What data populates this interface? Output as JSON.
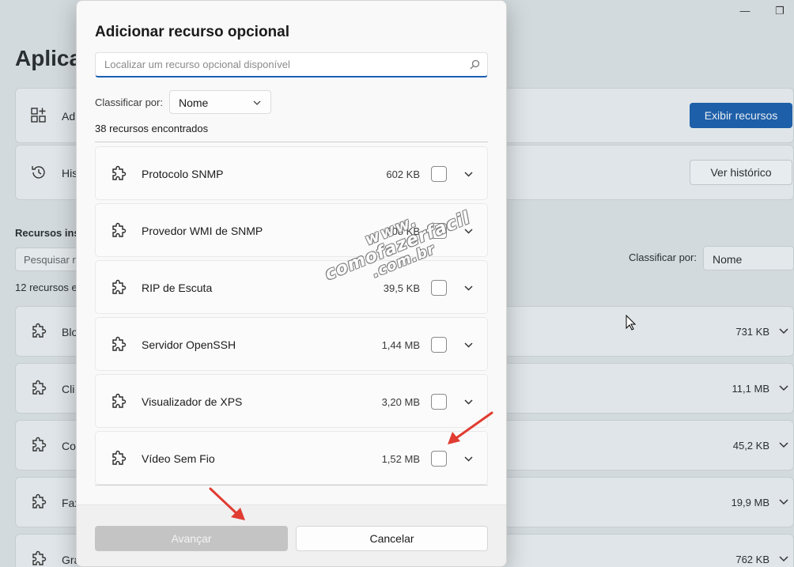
{
  "background": {
    "title": "Aplica",
    "cards": [
      {
        "label": "Ad",
        "icon": "add-grid-icon"
      },
      {
        "label": "His",
        "icon": "history-icon"
      }
    ],
    "view_features_button": "Exibir recursos",
    "view_history_button": "Ver histórico",
    "installed_section": "Recursos ins",
    "search_placeholder": "Pesquisar r",
    "sort_label": "Classificar por:",
    "sort_value": "Nome",
    "count": "12 recursos e",
    "rows": [
      {
        "label": "Blo",
        "size": "731 KB"
      },
      {
        "label": "Cli",
        "size": "11,1 MB"
      },
      {
        "label": "Co",
        "size": "45,2 KB"
      },
      {
        "label": "Fax",
        "size": "19,9 MB"
      },
      {
        "label": "Gra",
        "size": "762 KB"
      }
    ]
  },
  "dialog": {
    "title": "Adicionar recurso opcional",
    "search_placeholder": "Localizar um recurso opcional disponível",
    "sort_label": "Classificar por:",
    "sort_value": "Nome",
    "count": "38 recursos encontrados",
    "features": [
      {
        "name": "Protocolo SNMP",
        "size": "602 KB"
      },
      {
        "name": "Provedor WMI de SNMP",
        "size": "808 KB"
      },
      {
        "name": "RIP de Escuta",
        "size": "39,5 KB"
      },
      {
        "name": "Servidor OpenSSH",
        "size": "1,44 MB"
      },
      {
        "name": "Visualizador de XPS",
        "size": "3,20 MB"
      },
      {
        "name": "Vídeo Sem Fio",
        "size": "1,52 MB"
      }
    ],
    "next_button": "Avançar",
    "cancel_button": "Cancelar"
  },
  "watermark": {
    "line1": "www.",
    "line2": "comofazerfacil",
    "line3": ".com.br"
  },
  "colors": {
    "accent": "#1a5fb4",
    "arrow": "#e03c31",
    "disabled_button": "#c4c4c4"
  }
}
